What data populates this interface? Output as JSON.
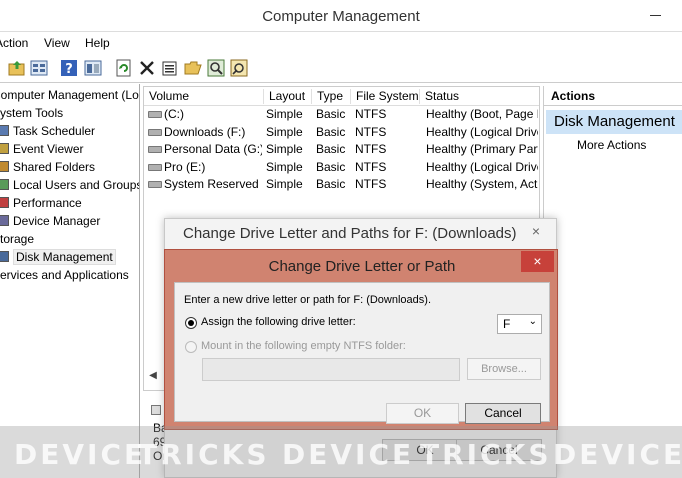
{
  "window": {
    "title": "Computer Management"
  },
  "menu": [
    "Action",
    "View",
    "Help"
  ],
  "toolbar_icons": [
    "folder-up-icon",
    "grid-icon",
    "help-icon",
    "panel-icon",
    "refresh-icon",
    "delete-icon",
    "properties-icon",
    "open-folder-icon",
    "search-icon",
    "wizard-icon"
  ],
  "tree": {
    "items": [
      {
        "label": "Computer Management (Local",
        "indent": 0
      },
      {
        "label": "System Tools",
        "indent": 0
      },
      {
        "label": "Task Scheduler",
        "indent": 1
      },
      {
        "label": "Event Viewer",
        "indent": 1
      },
      {
        "label": "Shared Folders",
        "indent": 1
      },
      {
        "label": "Local Users and Groups",
        "indent": 1
      },
      {
        "label": "Performance",
        "indent": 1
      },
      {
        "label": "Device Manager",
        "indent": 1
      },
      {
        "label": "Storage",
        "indent": 0
      },
      {
        "label": "Disk Management",
        "indent": 1,
        "selected": true
      },
      {
        "label": "Services and Applications",
        "indent": 0
      }
    ]
  },
  "volumes": {
    "headers": [
      "Volume",
      "Layout",
      "Type",
      "File System",
      "Status"
    ],
    "rows": [
      [
        "(C:)",
        "Simple",
        "Basic",
        "NTFS",
        "Healthy (Boot, Page F"
      ],
      [
        "Downloads (F:)",
        "Simple",
        "Basic",
        "NTFS",
        "Healthy (Logical Drive"
      ],
      [
        "Personal Data (G:)",
        "Simple",
        "Basic",
        "NTFS",
        "Healthy (Primary Part"
      ],
      [
        "Pro (E:)",
        "Simple",
        "Basic",
        "NTFS",
        "Healthy (Logical Drive"
      ],
      [
        "System Reserved",
        "Simple",
        "Basic",
        "NTFS",
        "Healthy (System, Acti"
      ]
    ]
  },
  "graph_partial": [
    "Ba",
    "69",
    "Or"
  ],
  "actions": {
    "header": "Actions",
    "section": "Disk Management",
    "more": "More Actions"
  },
  "dialog_back": {
    "title": "Change Drive Letter and Paths for F: (Downloads)",
    "ok": "OK",
    "cancel": "Cancel",
    "close": "×"
  },
  "dialog_front": {
    "title": "Change Drive Letter or Path",
    "close": "×",
    "prompt": "Enter a new drive letter or path for F: (Downloads).",
    "option_assign": "Assign the following drive letter:",
    "drive_letter": "F",
    "option_mount": "Mount in the following empty NTFS folder:",
    "browse": "Browse...",
    "ok": "OK",
    "cancel": "Cancel"
  },
  "watermark": [
    "DEVICE",
    "TRICKS",
    "DEVICE",
    "TRICKS",
    "DEVICE"
  ],
  "colors": {
    "dialog_front_frame": "#d08370",
    "close_red": "#c7413a",
    "actions_selected": "#cde3f7"
  }
}
